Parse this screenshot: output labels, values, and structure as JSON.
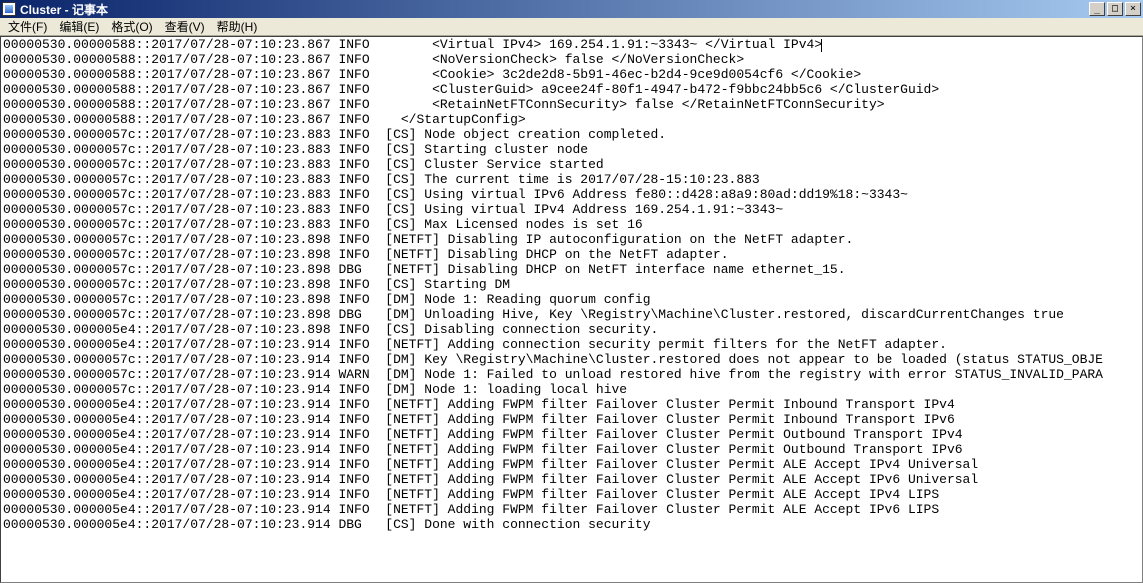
{
  "window": {
    "title": "Cluster - 记事本"
  },
  "menu": {
    "items": [
      "文件(F)",
      "编辑(E)",
      "格式(O)",
      "查看(V)",
      "帮助(H)"
    ]
  },
  "winbuttons": {
    "min": "_",
    "max": "□",
    "close": "×"
  },
  "log": {
    "lines": [
      "00000530.00000588::2017/07/28-07:10:23.867 INFO        <Virtual IPv4> 169.254.1.91:~3343~ </Virtual IPv4>",
      "00000530.00000588::2017/07/28-07:10:23.867 INFO        <NoVersionCheck> false </NoVersionCheck>",
      "00000530.00000588::2017/07/28-07:10:23.867 INFO        <Cookie> 3c2de2d8-5b91-46ec-b2d4-9ce9d0054cf6 </Cookie>",
      "00000530.00000588::2017/07/28-07:10:23.867 INFO        <ClusterGuid> a9cee24f-80f1-4947-b472-f9bbc24bb5c6 </ClusterGuid>",
      "00000530.00000588::2017/07/28-07:10:23.867 INFO        <RetainNetFTConnSecurity> false </RetainNetFTConnSecurity>",
      "00000530.00000588::2017/07/28-07:10:23.867 INFO    </StartupConfig>",
      "00000530.0000057c::2017/07/28-07:10:23.883 INFO  [CS] Node object creation completed.",
      "00000530.0000057c::2017/07/28-07:10:23.883 INFO  [CS] Starting cluster node",
      "00000530.0000057c::2017/07/28-07:10:23.883 INFO  [CS] Cluster Service started",
      "00000530.0000057c::2017/07/28-07:10:23.883 INFO  [CS] The current time is 2017/07/28-15:10:23.883",
      "00000530.0000057c::2017/07/28-07:10:23.883 INFO  [CS] Using virtual IPv6 Address fe80::d428:a8a9:80ad:dd19%18:~3343~",
      "00000530.0000057c::2017/07/28-07:10:23.883 INFO  [CS] Using virtual IPv4 Address 169.254.1.91:~3343~",
      "00000530.0000057c::2017/07/28-07:10:23.883 INFO  [CS] Max Licensed nodes is set 16",
      "00000530.0000057c::2017/07/28-07:10:23.898 INFO  [NETFT] Disabling IP autoconfiguration on the NetFT adapter.",
      "00000530.0000057c::2017/07/28-07:10:23.898 INFO  [NETFT] Disabling DHCP on the NetFT adapter.",
      "00000530.0000057c::2017/07/28-07:10:23.898 DBG   [NETFT] Disabling DHCP on NetFT interface name ethernet_15.",
      "00000530.0000057c::2017/07/28-07:10:23.898 INFO  [CS] Starting DM",
      "00000530.0000057c::2017/07/28-07:10:23.898 INFO  [DM] Node 1: Reading quorum config",
      "00000530.0000057c::2017/07/28-07:10:23.898 DBG   [DM] Unloading Hive, Key \\Registry\\Machine\\Cluster.restored, discardCurrentChanges true",
      "00000530.000005e4::2017/07/28-07:10:23.898 INFO  [CS] Disabling connection security.",
      "00000530.000005e4::2017/07/28-07:10:23.914 INFO  [NETFT] Adding connection security permit filters for the NetFT adapter.",
      "00000530.0000057c::2017/07/28-07:10:23.914 INFO  [DM] Key \\Registry\\Machine\\Cluster.restored does not appear to be loaded (status STATUS_OBJE",
      "00000530.0000057c::2017/07/28-07:10:23.914 WARN  [DM] Node 1: Failed to unload restored hive from the registry with error STATUS_INVALID_PARA",
      "00000530.0000057c::2017/07/28-07:10:23.914 INFO  [DM] Node 1: loading local hive",
      "00000530.000005e4::2017/07/28-07:10:23.914 INFO  [NETFT] Adding FWPM filter Failover Cluster Permit Inbound Transport IPv4",
      "00000530.000005e4::2017/07/28-07:10:23.914 INFO  [NETFT] Adding FWPM filter Failover Cluster Permit Inbound Transport IPv6",
      "00000530.000005e4::2017/07/28-07:10:23.914 INFO  [NETFT] Adding FWPM filter Failover Cluster Permit Outbound Transport IPv4",
      "00000530.000005e4::2017/07/28-07:10:23.914 INFO  [NETFT] Adding FWPM filter Failover Cluster Permit Outbound Transport IPv6",
      "00000530.000005e4::2017/07/28-07:10:23.914 INFO  [NETFT] Adding FWPM filter Failover Cluster Permit ALE Accept IPv4 Universal",
      "00000530.000005e4::2017/07/28-07:10:23.914 INFO  [NETFT] Adding FWPM filter Failover Cluster Permit ALE Accept IPv6 Universal",
      "00000530.000005e4::2017/07/28-07:10:23.914 INFO  [NETFT] Adding FWPM filter Failover Cluster Permit ALE Accept IPv4 LIPS",
      "00000530.000005e4::2017/07/28-07:10:23.914 INFO  [NETFT] Adding FWPM filter Failover Cluster Permit ALE Accept IPv6 LIPS",
      "00000530.000005e4::2017/07/28-07:10:23.914 DBG   [CS] Done with connection security"
    ],
    "cursor_line": 0
  }
}
